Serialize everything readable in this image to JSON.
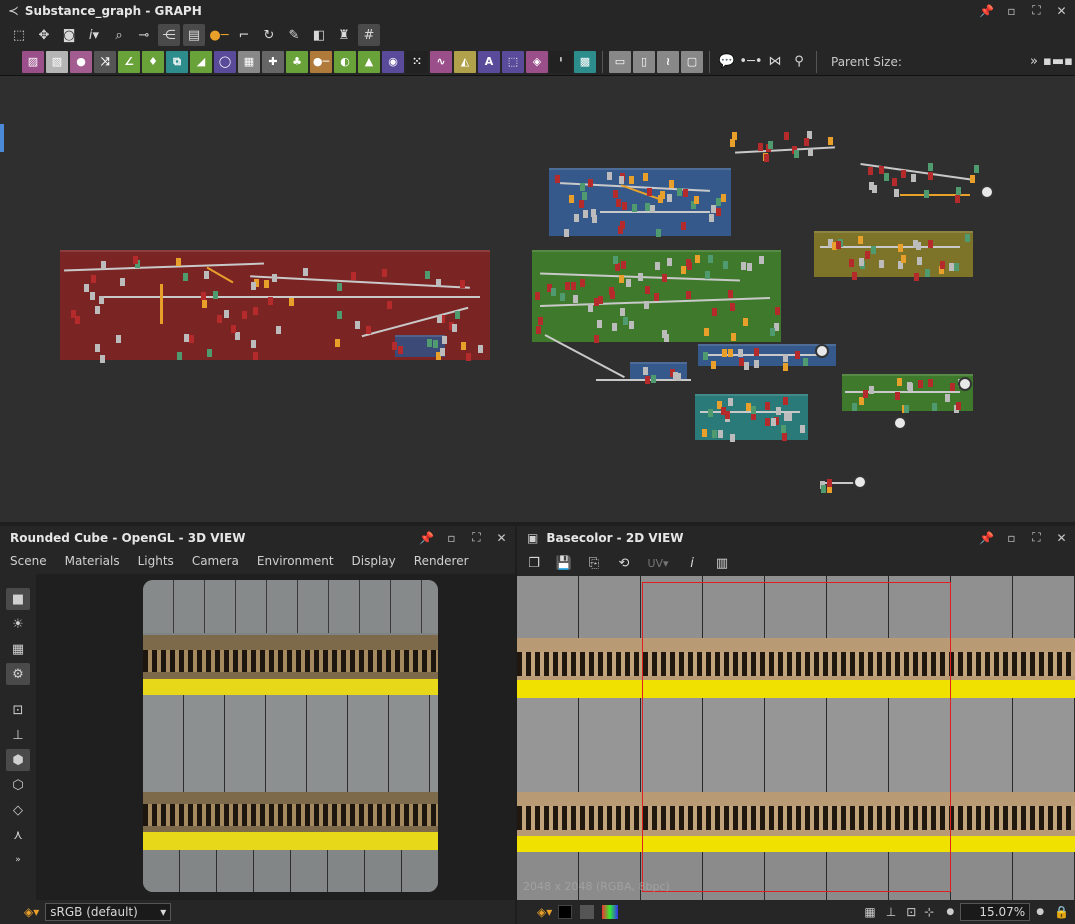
{
  "graph_window": {
    "title": "Substance_graph - GRAPH",
    "parent_size_label": "Parent Size:",
    "more_icon": "double-chevron-right-icon",
    "toolbar_icons": [
      "frame-select-icon",
      "move-icon",
      "camera-icon",
      "info-icon",
      "search-icon",
      "link-icon",
      "hierarchy-icon",
      "layers-icon",
      "connect-icon",
      "path-icon",
      "reset-icon",
      "wrench-icon",
      "display-icon",
      "brush-icon",
      "grid-icon"
    ],
    "node_atoms": [
      {
        "icon": "bitmap-icon",
        "color": "#9a4f8a"
      },
      {
        "icon": "svg-icon",
        "color": "#b5b5b5"
      },
      {
        "icon": "blur-icon",
        "color": "#a25c8f"
      },
      {
        "icon": "shuffle-icon",
        "color": "#555"
      },
      {
        "icon": "curve-icon",
        "color": "#6aa23a"
      },
      {
        "icon": "dots-icon",
        "color": "#6aa23a"
      },
      {
        "icon": "warp-icon",
        "color": "#2d8c8c"
      },
      {
        "icon": "gradient-icon",
        "color": "#6aa23a"
      },
      {
        "icon": "circle-icon",
        "color": "#5a4a9a"
      },
      {
        "icon": "tiles-icon",
        "color": "#888"
      },
      {
        "icon": "plus-icon",
        "color": "#666"
      },
      {
        "icon": "blend-icon",
        "color": "#6aa23a"
      },
      {
        "icon": "slider-icon",
        "color": "#b07a3a"
      },
      {
        "icon": "levels-icon",
        "color": "#6aa23a"
      },
      {
        "icon": "hist-icon",
        "color": "#6aa23a"
      },
      {
        "icon": "hue-icon",
        "color": "#5a4a9a"
      },
      {
        "icon": "noise-icon",
        "color": "#222"
      },
      {
        "icon": "curve2-icon",
        "color": "#9a4f8a"
      },
      {
        "icon": "triangle-icon",
        "color": "#b0a14a"
      },
      {
        "icon": "text-icon",
        "color": "#5a4a9a"
      },
      {
        "icon": "transform-icon",
        "color": "#5a4a9a"
      },
      {
        "icon": "fill-icon",
        "color": "#9a4f8a"
      },
      {
        "icon": "binary-icon",
        "color": "#222"
      },
      {
        "icon": "pattern-icon",
        "color": "#2d8c8c"
      },
      {
        "icon": "input-icon",
        "color": "#888"
      },
      {
        "icon": "output-icon",
        "color": "#888"
      },
      {
        "icon": "flow-icon",
        "color": "#888"
      },
      {
        "icon": "frame-icon",
        "color": "#888"
      }
    ],
    "extra_icons": [
      "comment-icon",
      "pin-icon",
      "split-icon",
      "anchor-icon"
    ]
  },
  "view3d": {
    "title": "Rounded Cube - OpenGL - 3D VIEW",
    "menu": [
      "Scene",
      "Materials",
      "Lights",
      "Camera",
      "Environment",
      "Display",
      "Renderer"
    ],
    "colorspace": "sRGB (default)"
  },
  "view2d": {
    "title": "Basecolor - 2D VIEW",
    "uv_label": "UV",
    "resolution_label": "2048 x 2048 (RGBA, 8bpc)",
    "zoom": "15.07%"
  }
}
